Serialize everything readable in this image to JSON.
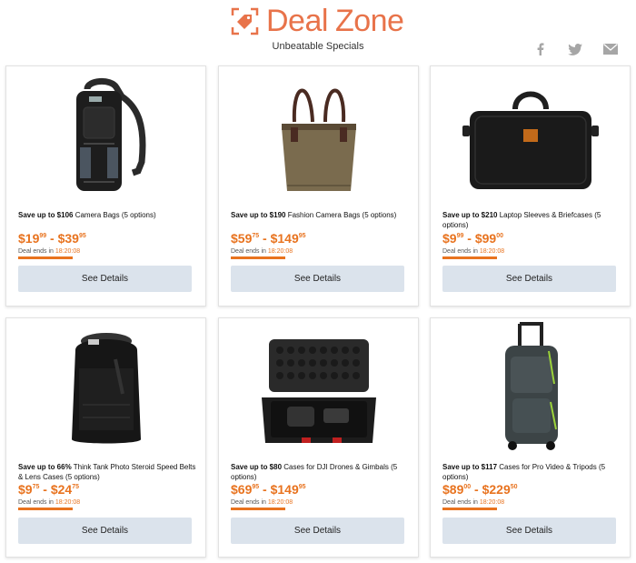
{
  "brand": {
    "name_part1": "Deal",
    "name_part2": "Zone",
    "tagline": "Unbeatable Specials",
    "color": "#e8734a"
  },
  "social": [
    "facebook-icon",
    "twitter-icon",
    "mail-icon"
  ],
  "accent_color": "#e8731f",
  "button_color": "#dbe3ec",
  "deals": [
    {
      "save_prefix": "Save up to $106",
      "name": " Camera Bags (5 options)",
      "price_low": "$19",
      "price_low_cents": "99",
      "price_sep": " - ",
      "price_high": "$39",
      "price_high_cents": "95",
      "ends_label": "Deal ends in ",
      "ends_time": "18:20:08",
      "button": "See Details",
      "image": "sling-backpack"
    },
    {
      "save_prefix": "Save up to $190",
      "name": " Fashion Camera Bags (5 options)",
      "price_low": "$59",
      "price_low_cents": "75",
      "price_sep": " - ",
      "price_high": "$149",
      "price_high_cents": "95",
      "ends_label": "Deal ends in ",
      "ends_time": "18:20:08",
      "button": "See Details",
      "image": "tote-bag"
    },
    {
      "save_prefix": "Save up to $210",
      "name": " Laptop Sleeves & Briefcases (5 options)",
      "price_low": "$9",
      "price_low_cents": "99",
      "price_sep": " - ",
      "price_high": "$99",
      "price_high_cents": "00",
      "ends_label": "Deal ends in ",
      "ends_time": "18:20:08",
      "button": "See Details",
      "image": "laptop-sleeve"
    },
    {
      "save_prefix": "Save up to 66%",
      "name": " Think Tank Photo Steroid Speed Belts & Lens Cases (5 options)",
      "price_low": "$9",
      "price_low_cents": "75",
      "price_sep": " - ",
      "price_high": "$24",
      "price_high_cents": "75",
      "ends_label": "Deal ends in ",
      "ends_time": "18:20:08",
      "button": "See Details",
      "image": "lens-case"
    },
    {
      "save_prefix": "Save up to $80",
      "name": " Cases for DJI Drones & Gimbals (5 options)",
      "price_low": "$69",
      "price_low_cents": "95",
      "price_sep": " - ",
      "price_high": "$149",
      "price_high_cents": "95",
      "ends_label": "Deal ends in ",
      "ends_time": "18:20:08",
      "button": "See Details",
      "image": "hard-case"
    },
    {
      "save_prefix": "Save up to $117",
      "name": " Cases for Pro Video & Tripods (5 options)",
      "price_low": "$89",
      "price_low_cents": "00",
      "price_sep": " - ",
      "price_high": "$229",
      "price_high_cents": "50",
      "ends_label": "Deal ends in ",
      "ends_time": "18:20:08",
      "button": "See Details",
      "image": "rolling-bag"
    }
  ]
}
